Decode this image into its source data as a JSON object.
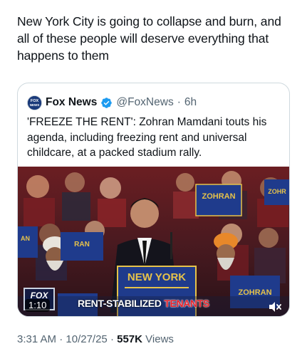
{
  "post": {
    "text": "New York City is going to collapse and burn, and all of these people will deserve everything that happens to them"
  },
  "quoted": {
    "avatar_label": "FOX NEWS",
    "name": "Fox News",
    "handle": "@FoxNews",
    "separator": "·",
    "time": "6h",
    "text": "'FREEZE THE RENT': Zohran Mamdani touts his agenda, including freezing rent and universal childcare, at a packed stadium rally."
  },
  "video": {
    "duration": "1:10",
    "chyron_white": "RENT-STABILIZED",
    "chyron_red": "TENANTS",
    "bug_label": "FOX",
    "podium_text": "NEW YORK",
    "sign_text": "ZOHRAN"
  },
  "meta": {
    "time": "3:31 AM",
    "sep1": "·",
    "date": "10/27/25",
    "sep2": "·",
    "views_count": "557K",
    "views_label": "Views"
  },
  "colors": {
    "text_primary": "#0f1419",
    "text_secondary": "#536471",
    "border": "#cfd9de",
    "verified": "#1d9bf0",
    "chyron_red": "#e8232b"
  }
}
